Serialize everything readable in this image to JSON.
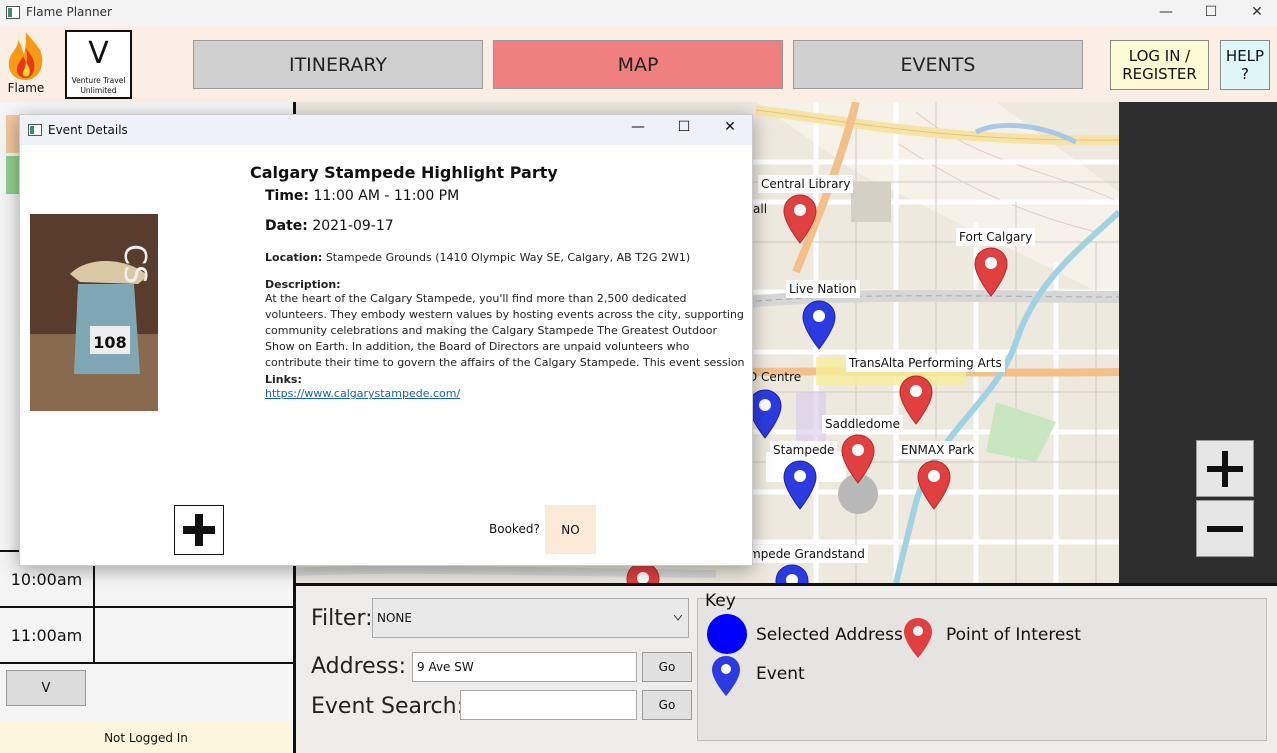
{
  "window": {
    "title": "Flame Planner",
    "minimize": "—",
    "maximize": "☐",
    "close": "✕"
  },
  "header": {
    "logo_label": "Flame",
    "venture_letter": "V",
    "venture_name": "Venture Travel Unlimited",
    "nav": {
      "itinerary": "ITINERARY",
      "map": "MAP",
      "events": "EVENTS"
    },
    "login": "LOG IN / REGISTER",
    "help": "HELP ?"
  },
  "itinerary": {
    "rows": [
      {
        "time": "10:00am"
      },
      {
        "time": "11:00am"
      }
    ],
    "collapse_button": "V",
    "status": "Not Logged In"
  },
  "map": {
    "labels": {
      "central_library": "Central Library",
      "fort_calgary": "Fort Calgary",
      "live_nation": "Live Nation",
      "transalta": "TransAlta Performing Arts",
      "centre": "D Centre",
      "saddledome": "Saddledome",
      "stampede": "Stampede",
      "enmax": "ENMAX Park",
      "grandstand": "mpede Grandstand",
      "hall": "all"
    },
    "zoom_in": "+",
    "zoom_out": "−"
  },
  "controls": {
    "filter_label": "Filter:",
    "filter_value": "NONE",
    "address_label": "Address:",
    "address_value": "9 Ave SW",
    "event_search_label": "Event Search:",
    "event_search_value": "",
    "go": "Go"
  },
  "key": {
    "title": "Key",
    "selected_address": "Selected Address",
    "point_of_interest": "Point of Interest",
    "event": "Event"
  },
  "dialog": {
    "title": "Event Details",
    "event_title": "Calgary Stampede Highlight Party",
    "time_label": "Time:",
    "time_value": "11:00 AM - 11:00 PM",
    "date_label": "Date:",
    "date_value": "2021-09-17",
    "location_label": "Location:",
    "location_value": "Stampede Grounds (1410 Olympic Way SE, Calgary, AB T2G 2W1)",
    "description_label": "Description:",
    "description": "At the heart of the Calgary Stampede, you'll find more than 2,500 dedicated volunteers. They embody western values by hosting events across the city, supporting community celebrations and making the Calgary Stampede The Greatest Outdoor Show on Earth. In addition, the Board of Directors are unpaid volunteers who contribute their time to govern the affairs of the Calgary Stampede. This event session is a party for all those hard workers.",
    "links_label": "Links:",
    "link": "https://www.calgarystampede.com/",
    "booked_label": "Booked?",
    "booked_value": "NO",
    "poster_number": "108",
    "add_symbol": "+"
  },
  "colors": {
    "map_tab": "#f08080",
    "poi_pin": "#e04040",
    "event_pin": "#2c3be0",
    "login_bg": "#fcfad2",
    "help_bg": "#dff7f8"
  }
}
